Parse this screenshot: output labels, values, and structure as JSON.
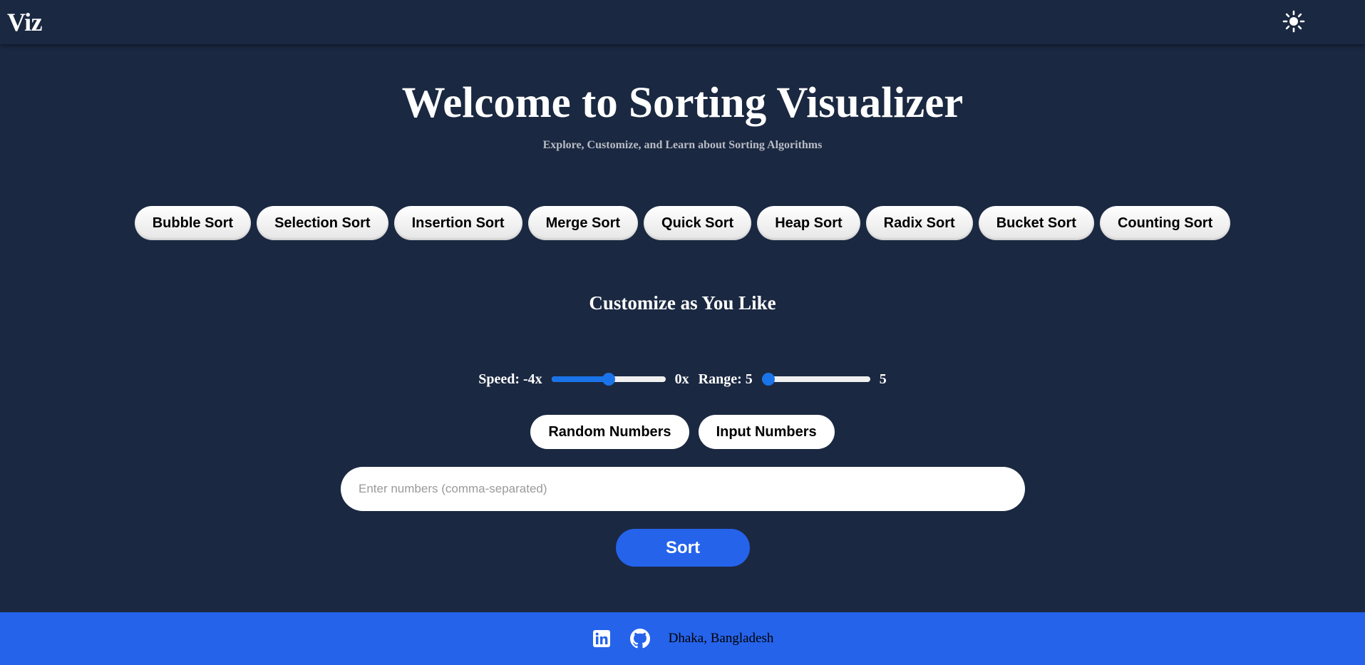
{
  "header": {
    "logo": "Viz",
    "theme_toggle_icon": "sun-icon"
  },
  "hero": {
    "title": "Welcome to Sorting Visualizer",
    "subtitle": "Explore, Customize, and Learn about Sorting Algorithms"
  },
  "algorithms": [
    {
      "label": "Bubble Sort"
    },
    {
      "label": "Selection Sort"
    },
    {
      "label": "Insertion Sort"
    },
    {
      "label": "Merge Sort"
    },
    {
      "label": "Quick Sort"
    },
    {
      "label": "Heap Sort"
    },
    {
      "label": "Radix Sort"
    },
    {
      "label": "Bucket Sort"
    },
    {
      "label": "Counting Sort"
    }
  ],
  "customize": {
    "title": "Customize as You Like",
    "speed": {
      "label": "Speed: -4x",
      "value_label": "0x",
      "fraction": 0.5
    },
    "range": {
      "label": "Range: 5",
      "value_label": "5",
      "fraction": 0.0
    }
  },
  "modes": {
    "random_label": "Random Numbers",
    "input_label": "Input Numbers"
  },
  "numbers_input": {
    "placeholder": "Enter numbers (comma-separated)",
    "value": ""
  },
  "sort_button": "Sort",
  "footer": {
    "linkedin_icon": "linkedin-icon",
    "github_icon": "github-icon",
    "location": "Dhaka, Bangladesh"
  },
  "colors": {
    "background": "#1a2841",
    "accent": "#2563eb",
    "slider_accent": "#1a73e8"
  }
}
